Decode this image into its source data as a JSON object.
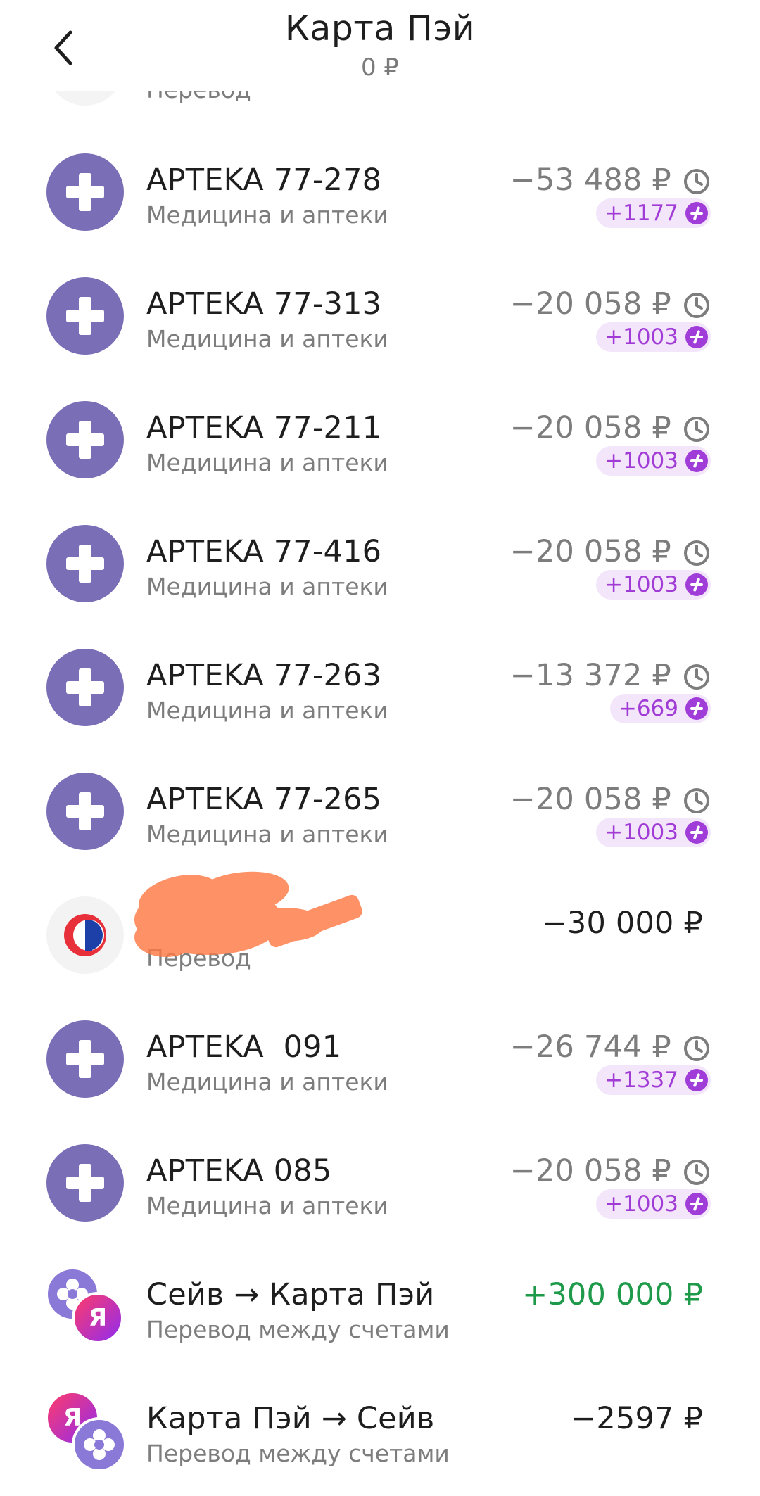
{
  "header": {
    "title": "Карта Пэй",
    "balance": "0 ₽"
  },
  "partial_top": {
    "category": "Перевод"
  },
  "transactions": [
    {
      "name": "APTEKA 77-278",
      "category": "Медицина и аптеки",
      "amount": "−53 488 ₽",
      "cashback": "+1177",
      "pending": true
    },
    {
      "name": "APTEKA 77-313",
      "category": "Медицина и аптеки",
      "amount": "−20 058 ₽",
      "cashback": "+1003",
      "pending": true
    },
    {
      "name": "APTEKA 77-211",
      "category": "Медицина и аптеки",
      "amount": "−20 058 ₽",
      "cashback": "+1003",
      "pending": true
    },
    {
      "name": "APTEKA 77-416",
      "category": "Медицина и аптеки",
      "amount": "−20 058 ₽",
      "cashback": "+1003",
      "pending": true
    },
    {
      "name": "APTEKA 77-263",
      "category": "Медицина и аптеки",
      "amount": "−13 372 ₽",
      "cashback": "+669",
      "pending": true
    },
    {
      "name": "APTEKA 77-265",
      "category": "Медицина и аптеки",
      "amount": "−20 058 ₽",
      "cashback": "+1003",
      "pending": true
    },
    {
      "name": "",
      "category": "Перевод",
      "amount": "−30 000 ₽",
      "cashback": "",
      "pending": false
    },
    {
      "name": "APTEKA  091",
      "category": "Медицина и аптеки",
      "amount": "−26 744 ₽",
      "cashback": "+1337",
      "pending": true
    },
    {
      "name": "APTEKA 085",
      "category": "Медицина и аптеки",
      "amount": "−20 058 ₽",
      "cashback": "+1003",
      "pending": true
    },
    {
      "name": "Сейв → Карта Пэй",
      "category": "Перевод между счетами",
      "amount": "+300 000 ₽",
      "cashback": "",
      "pending": false
    },
    {
      "name": "Карта Пэй → Сейв",
      "category": "Перевод между счетами",
      "amount": "−2597 ₽",
      "cashback": "",
      "pending": false
    }
  ],
  "colors": {
    "pharmacy_icon": "#7a6fb6",
    "cashback_text": "#a13bd6",
    "cashback_bg": "#f3e6fb",
    "income": "#1e9a4a",
    "muted": "#7d7d7d",
    "redaction": "#ff7a45"
  },
  "icons": {
    "back": "chevron-left-icon",
    "pharmacy": "medical-cross-icon",
    "pending": "clock-icon",
    "cashback": "plus-points-icon",
    "bank": "sber-logo-icon",
    "savings": "flower-icon",
    "yandex": "yandex-badge-icon"
  }
}
